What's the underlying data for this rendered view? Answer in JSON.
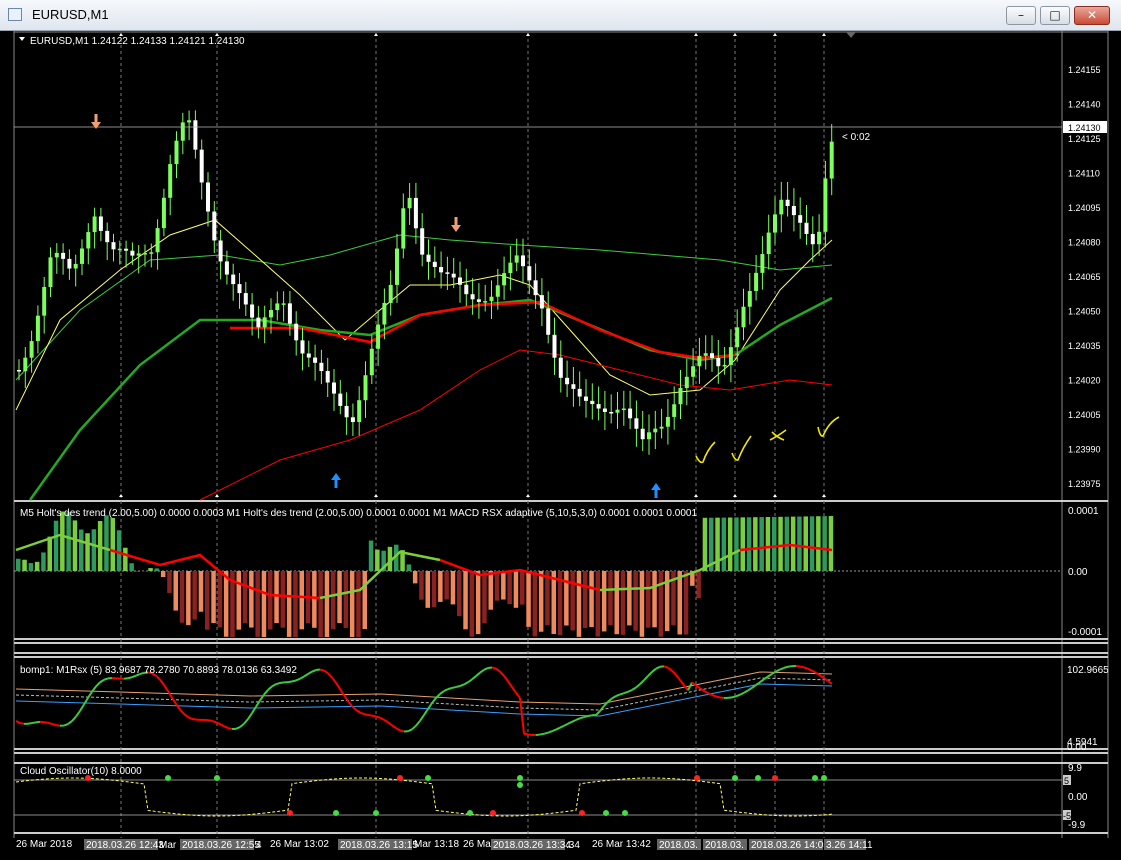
{
  "window": {
    "title": "EURUSD,M1",
    "minimize_glyph": "–",
    "maximize_glyph": "□",
    "close_glyph": "✕"
  },
  "main_chart": {
    "header": "EURUSD,M1  1.24122 1.24133 1.24121 1.24130",
    "countdown": "< 0:02",
    "current_price_label": "1.24130",
    "price_axis_labels": [
      "1.24155",
      "1.24140",
      "1.24125",
      "1.24110",
      "1.24095",
      "1.24080",
      "1.24065",
      "1.24050",
      "1.24035",
      "1.24020",
      "1.24005",
      "1.23990",
      "1.23975"
    ]
  },
  "macd_panel": {
    "header": "M5 Holt's des trend (2.00,5.00) 0.0000 0.0003  M1 Holt's des trend (2.00,5.00) 0.0001 0.0001  M1 MACD RSX adaptive (5,10,5,3,0) 0.0001 0.0001 0.0001",
    "axis_labels": [
      "0.0001",
      "0.00",
      "-0.0001"
    ]
  },
  "rsx_panel": {
    "header": "bomp1: M1Rsx (5) 83.9687 78.2780 70.8893 78.0136 63.3492",
    "axis_labels": [
      "102.9665",
      "4.5941",
      "0.00"
    ]
  },
  "cloud_panel": {
    "header": "Cloud Oscillator(10) 8.0000",
    "axis_labels": [
      "9.9",
      "5",
      "0.00",
      "-5",
      "-9.9"
    ]
  },
  "time_axis": {
    "labels": [
      "26 Mar 2018",
      "2018.03.26 12:43",
      "Mar",
      "2018.03.26 12:55",
      "4",
      "26 Mar 13:02",
      "2018.03.26 13:15",
      "Mar 13:18",
      "26 Ma",
      "2018.03.26 13:34",
      ":34",
      "26 Mar 13:42",
      "2018.03.",
      "2018.03.",
      "2018.03.26 14:05",
      "3.26 14:11"
    ]
  },
  "colors": {
    "background": "#000000",
    "bull_candle": "#7cff5c",
    "bear_candle": "#ffffff",
    "red_line": "#ff0000",
    "yellow_line": "#ffff66",
    "dark_green_line": "#22aa22",
    "light_green_line": "#3dcc3d",
    "hist_green_light": "#7ccf3c",
    "hist_green_dark": "#2e9a5e",
    "hist_red_light": "#f08a5d",
    "hist_red_dark": "#8b2222",
    "arrow_down": "#f0a070",
    "arrow_up": "#1e90ff"
  }
}
